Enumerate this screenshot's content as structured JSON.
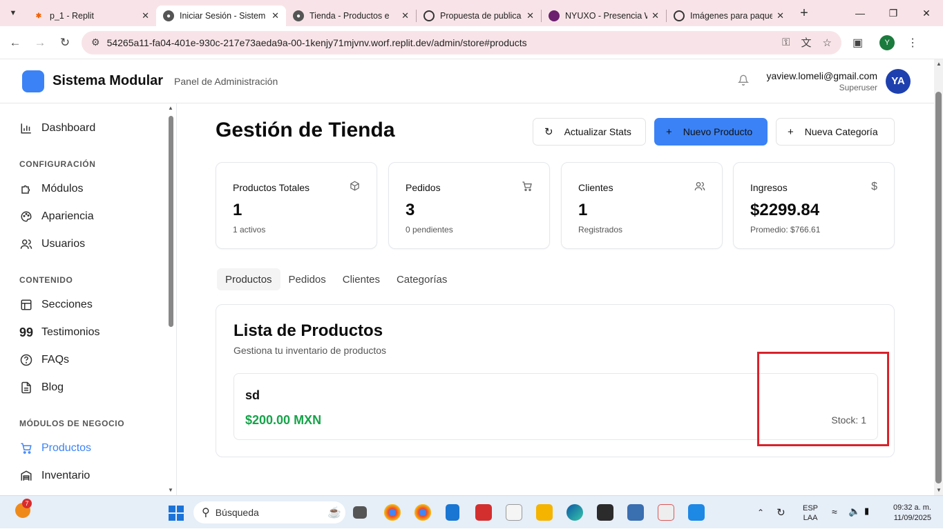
{
  "browser": {
    "tabs": [
      {
        "title": "p_1 - Replit",
        "icon": "replit-icon",
        "active": false
      },
      {
        "title": "Iniciar Sesión - Sistem",
        "icon": "globe-icon",
        "active": true
      },
      {
        "title": "Tienda - Productos e",
        "icon": "globe-icon",
        "active": false
      },
      {
        "title": "Propuesta de publica",
        "icon": "chatgpt-icon",
        "active": false
      },
      {
        "title": "NYUXO - Presencia W",
        "icon": "nyuxo-icon",
        "active": false
      },
      {
        "title": "Imágenes para paque",
        "icon": "chatgpt-icon",
        "active": false
      }
    ],
    "url": "54265a11-fa04-401e-930c-217e73aeda9a-00-1kenjy71mjvnv.worf.replit.dev/admin/store#products",
    "profile_initial": "Y"
  },
  "header": {
    "brand": "Sistema Modular",
    "subtitle": "Panel de Administración",
    "user_email": "yaview.lomeli@gmail.com",
    "user_role": "Superuser",
    "avatar_initials": "YA"
  },
  "sidebar": {
    "dashboard": "Dashboard",
    "section_config": "CONFIGURACIÓN",
    "modulos": "Módulos",
    "apariencia": "Apariencia",
    "usuarios": "Usuarios",
    "section_content": "CONTENIDO",
    "secciones": "Secciones",
    "testimonios": "Testimonios",
    "faqs": "FAQs",
    "blog": "Blog",
    "section_business": "MÓDULOS DE NEGOCIO",
    "productos": "Productos",
    "inventario": "Inventario"
  },
  "main": {
    "title": "Gestión de Tienda",
    "btn_refresh": "Actualizar Stats",
    "btn_new_product": "Nuevo Producto",
    "btn_new_category": "Nueva Categoría",
    "stats": [
      {
        "title": "Productos Totales",
        "value": "1",
        "sub": "1 activos",
        "icon": "package-icon"
      },
      {
        "title": "Pedidos",
        "value": "3",
        "sub": "0 pendientes",
        "icon": "cart-icon"
      },
      {
        "title": "Clientes",
        "value": "1",
        "sub": "Registrados",
        "icon": "users-icon"
      },
      {
        "title": "Ingresos",
        "value": "$2299.84",
        "sub": "Promedio: $766.61",
        "icon": "dollar-icon"
      }
    ],
    "tabs": [
      "Productos",
      "Pedidos",
      "Clientes",
      "Categorías"
    ],
    "list_title": "Lista de Productos",
    "list_subtitle": "Gestiona tu inventario de productos",
    "products": [
      {
        "name": "sd",
        "price": "$200.00 MXN",
        "stock": "Stock: 1"
      }
    ]
  },
  "taskbar": {
    "weather_badge": "7",
    "search_placeholder": "Búsqueda",
    "lang_line1": "ESP",
    "lang_line2": "LAA",
    "time": "09:32 a. m.",
    "date": "11/09/2025"
  },
  "colors": {
    "accent": "#3b82f6",
    "price": "#16a34a",
    "highlight": "#d9222a"
  }
}
